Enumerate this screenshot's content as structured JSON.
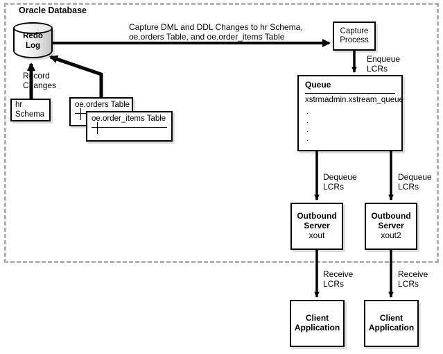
{
  "diagram": {
    "boundary_label": "Oracle Database",
    "boundary_style": "dashed",
    "accent_color": "#000000",
    "boundary_color": "#b4b4b4"
  },
  "redo_log": {
    "line1": "Redo",
    "line2": "Log"
  },
  "sources": {
    "hr_schema": {
      "line1": "hr",
      "line2": "Schema"
    },
    "oe_orders": {
      "name": "oe.orders Table"
    },
    "oe_order_items": {
      "name": "oe.order_items Table"
    }
  },
  "capture_process": {
    "line1": "Capture",
    "line2": "Process"
  },
  "queue": {
    "title": "Queue",
    "name": "xstrmadmin.xstream_queue",
    "dots": ".\n.\n.\n."
  },
  "outbound_servers": [
    {
      "line1": "Outbound",
      "line2": "Server",
      "name": "xout"
    },
    {
      "line1": "Outbound",
      "line2": "Server",
      "name": "xout2"
    }
  ],
  "client_applications": [
    {
      "line1": "Client",
      "line2": "Application"
    },
    {
      "line1": "Client",
      "line2": "Application"
    }
  ],
  "edge_labels": {
    "capture_changes": "Capture DML and DDL Changes to hr Schema,\noe.orders Table, and oe.order_items Table",
    "record_changes": "Record\nChanges",
    "enqueue_lcrs": "Enqueue\nLCRs",
    "dequeue_lcrs_1": "Dequeue\nLCRs",
    "dequeue_lcrs_2": "Dequeue\nLCRs",
    "receive_lcrs_1": "Receive\nLCRs",
    "receive_lcrs_2": "Receive\nLCRs"
  }
}
